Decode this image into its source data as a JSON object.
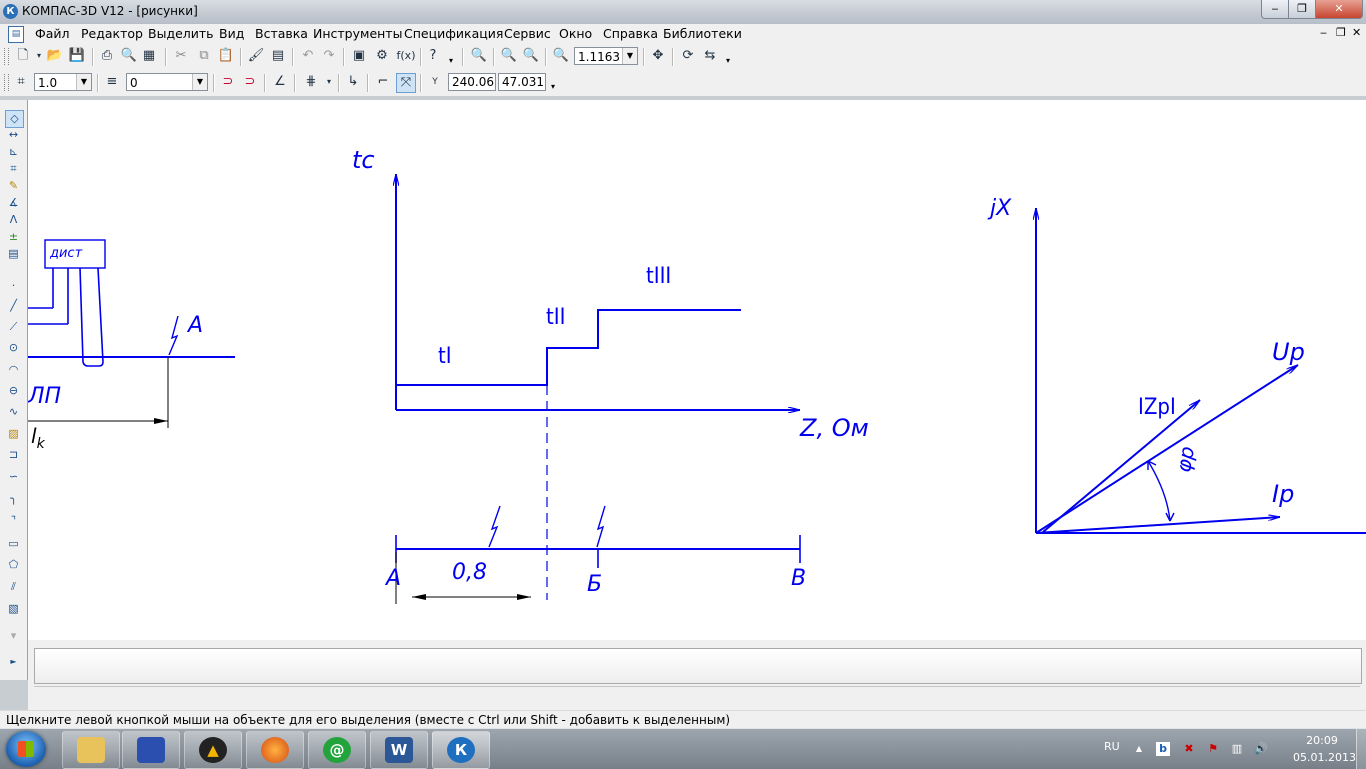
{
  "window": {
    "title": "КОМПАС-3D V12 - [рисунки]",
    "app_icon": "К",
    "minimize": "‒",
    "maximize": "❐",
    "close": "✕"
  },
  "menu": {
    "items": [
      "Файл",
      "Редактор",
      "Выделить",
      "Вид",
      "Вставка",
      "Инструменты",
      "Спецификация",
      "Сервис",
      "Окно",
      "Справка",
      "Библиотеки"
    ],
    "mdi_min": "‒",
    "mdi_restore": "❐",
    "mdi_close": "✕"
  },
  "toolbar1": {
    "zoom_value": "1.1163",
    "fx_label": "f(x)"
  },
  "toolbar2": {
    "scale_value": "1.0",
    "layer_value": "0",
    "coord_label": "Y",
    "coord_x": "240.06",
    "coord_y": "47.031"
  },
  "drawing": {
    "left_box_label": "дист",
    "left_point_label": "A",
    "left_cut_label": "ЛП",
    "left_lk_label": "l",
    "left_lk_sub": "k",
    "graph_y_label": "tc",
    "graph_x_label": "Z, Ом",
    "step1_label": "tI",
    "step2_label": "tII",
    "step3_label": "tIII",
    "line_label_a": "A",
    "line_label_b": "Б",
    "line_label_v": "В",
    "dim_label": "0,8",
    "vec_axis_label": "jX",
    "vec_up_label": "Up",
    "vec_zp_label": "IZpI",
    "vec_ip_label": "Ip",
    "vec_phi_label": "φр"
  },
  "status": {
    "text": "Щелкните левой кнопкой мыши на объекте для его выделения (вместе с Ctrl или Shift - добавить к выделенным)"
  },
  "taskbar": {
    "word_glyph": "W",
    "kompas_glyph": "К",
    "mail_glyph": "@",
    "language": "RU",
    "time": "20:09",
    "date": "05.01.2013"
  },
  "colors": {
    "drawing": "#0000ee",
    "canvas_bg": "#ffffff"
  }
}
